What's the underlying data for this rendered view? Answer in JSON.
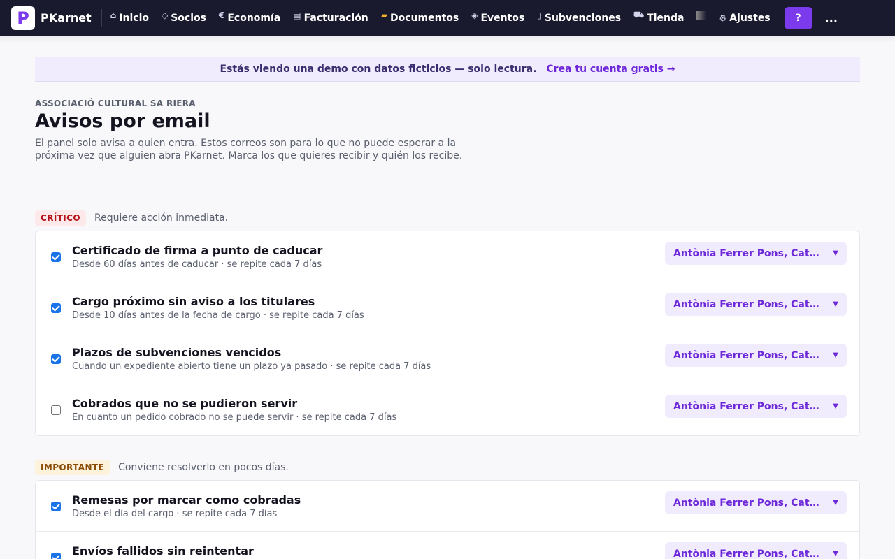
{
  "app": {
    "brand": "PKarnet",
    "logo_letter": "P",
    "accent": "#7c3aed"
  },
  "nav": {
    "items": [
      {
        "icon": "⌂",
        "icon_name": "home-icon",
        "label": "Inicio"
      },
      {
        "icon": "◇",
        "icon_name": "diamond-icon",
        "label": "Socios"
      },
      {
        "icon": "€",
        "icon_name": "euro-icon",
        "label": "Economía"
      },
      {
        "icon": "▤",
        "icon_name": "invoice-icon",
        "label": "Facturación"
      },
      {
        "icon": "▰",
        "icon_name": "folder-icon",
        "label": "Documentos"
      },
      {
        "icon": "◈",
        "icon_name": "event-icon",
        "label": "Eventos"
      },
      {
        "icon": "▯",
        "icon_name": "grants-icon",
        "label": "Subvenciones"
      },
      {
        "icon": "⛟",
        "icon_name": "cart-icon",
        "label": "Tienda"
      }
    ],
    "settings": {
      "icon": "⚙",
      "label": "Ajustes"
    },
    "help_label": "?",
    "more_label": "..."
  },
  "banner": {
    "text": "Estás viendo una demo con datos ficticios — solo lectura.",
    "link": "Crea tu cuenta gratis →"
  },
  "header": {
    "org": "ASSOCIACIÓ CULTURAL SA RIERA",
    "title": "Avisos por email",
    "description": "El panel solo avisa a quien entra. Estos correos son para lo que no puede esperar a la próxima vez que alguien abra PKarnet. Marca los que quieres recibir y quién los recibe."
  },
  "sections": [
    {
      "badge": "CRÍTICO",
      "note": "Requiere acción inmediata.",
      "items": [
        {
          "checked": true,
          "title": "Certificado de firma a punto de caducar",
          "sub": "Desde 60 días antes de caducar · se repite cada 7 días",
          "recipients": "Antònia Ferrer Pons, Caterina"
        },
        {
          "checked": true,
          "title": "Cargo próximo sin aviso a los titulares",
          "sub": "Desde 10 días antes de la fecha de cargo · se repite cada 7 días",
          "recipients": "Antònia Ferrer Pons, Caterina"
        },
        {
          "checked": true,
          "title": "Plazos de subvenciones vencidos",
          "sub": "Cuando un expediente abierto tiene un plazo ya pasado · se repite cada 7 días",
          "recipients": "Antònia Ferrer Pons, Caterina"
        },
        {
          "checked": false,
          "title": "Cobrados que no se pudieron servir",
          "sub": "En cuanto un pedido cobrado no se puede servir · se repite cada 7 días",
          "recipients": "Antònia Ferrer Pons, Caterina"
        }
      ]
    },
    {
      "badge": "IMPORTANTE",
      "note": "Conviene resolverlo en pocos días.",
      "items": [
        {
          "checked": true,
          "title": "Remesas por marcar como cobradas",
          "sub": "Desde el día del cargo · se repite cada 7 días",
          "recipients": "Antònia Ferrer Pons, Caterina"
        },
        {
          "checked": true,
          "title": "Envíos fallidos sin reintentar",
          "sub": "",
          "recipients": "Antònia Ferrer Pons, Caterina"
        }
      ]
    }
  ]
}
